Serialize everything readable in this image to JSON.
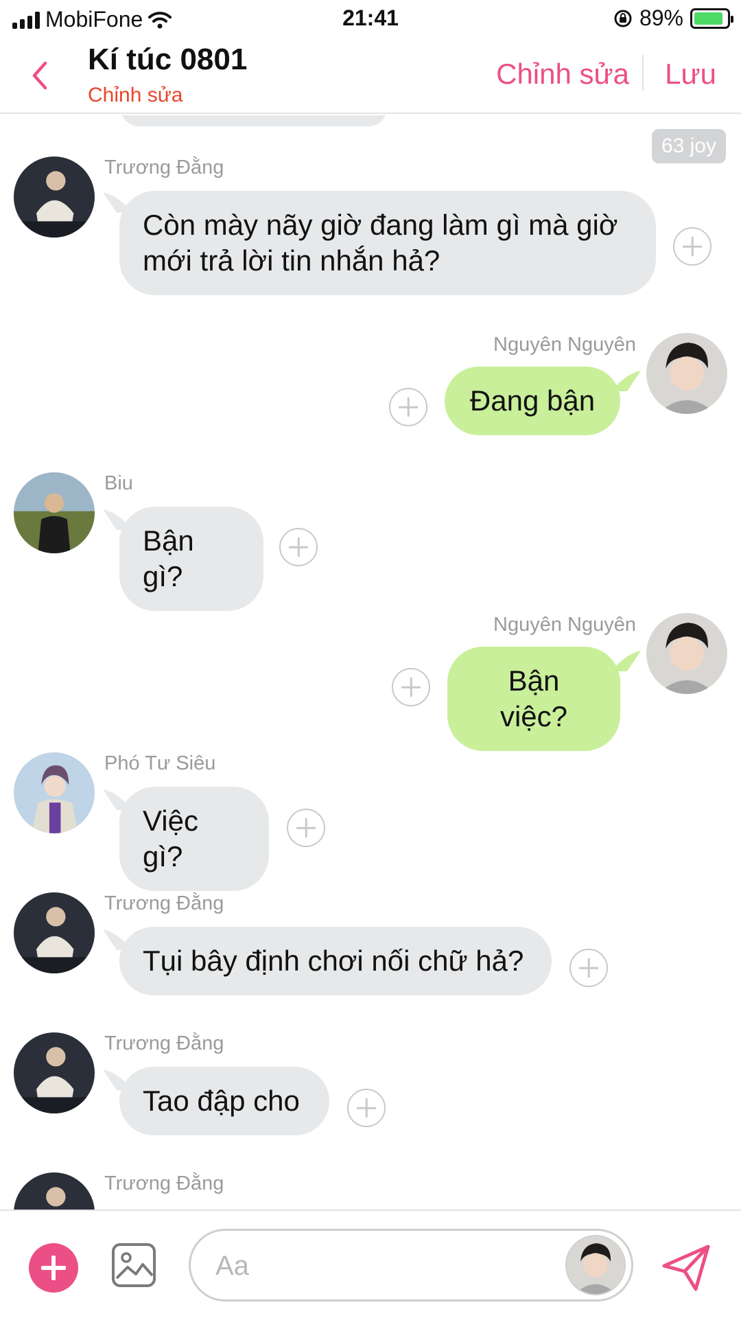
{
  "status_bar": {
    "carrier": "MobiFone",
    "time": "21:41",
    "battery": "89%",
    "battery_level": 0.89
  },
  "header": {
    "title": "Kí túc 0801",
    "subtitle": "Chỉnh sửa",
    "edit_label": "Chỉnh sửa",
    "save_label": "Lưu"
  },
  "badge": {
    "text": "63 joy"
  },
  "messages": [
    {
      "sender": "Trương Đằng",
      "text": "Còn mày nãy giờ đang làm gì mà giờ mới trả lời tin nhắn hả?",
      "direction": "incoming"
    },
    {
      "sender": "Nguyên Nguyên",
      "text": "Đang bận",
      "direction": "outgoing"
    },
    {
      "sender": "Biu",
      "text": "Bận gì?",
      "direction": "incoming"
    },
    {
      "sender": "Nguyên Nguyên",
      "text": "Bận việc?",
      "direction": "outgoing"
    },
    {
      "sender": "Phó Tư Siêu",
      "text": "Việc gì?",
      "direction": "incoming"
    },
    {
      "sender": "Trương Đằng",
      "text": "Tụi bây định chơi nối chữ hả?",
      "direction": "incoming"
    },
    {
      "sender": "Trương Đằng",
      "text": "Tao đập cho",
      "direction": "incoming"
    },
    {
      "sender": "Trương Đằng",
      "text": "",
      "direction": "incoming"
    }
  ],
  "composer": {
    "placeholder": "Aa"
  },
  "colors": {
    "accent": "#ec4f86",
    "subtitle": "#e8452c",
    "incoming_bubble": "#e6e8ea",
    "outgoing_bubble": "#c9ef9a"
  }
}
